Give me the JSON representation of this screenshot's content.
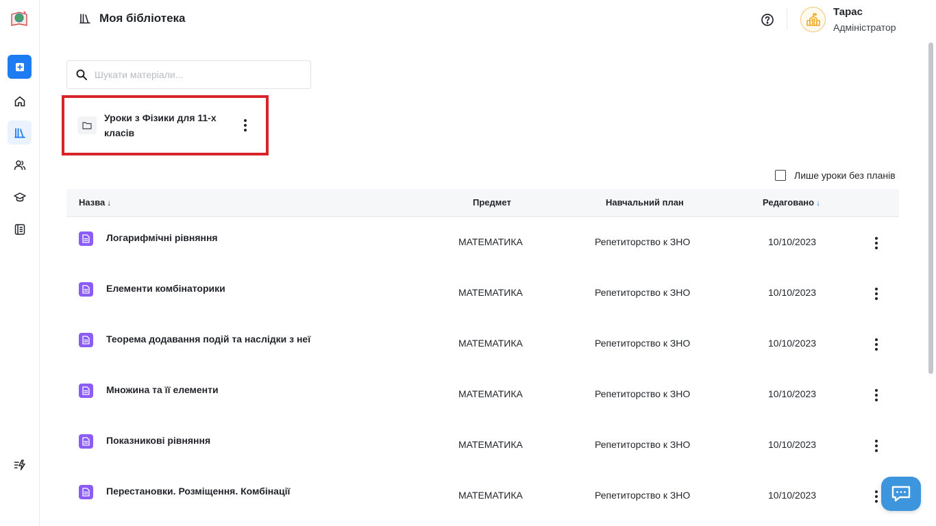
{
  "header": {
    "title": "Моя бібліотека",
    "user_name": "Тарас",
    "user_role": "Адміністратор"
  },
  "sidebar": {
    "items": [
      {
        "icon": "plus-square-icon"
      },
      {
        "icon": "home-icon"
      },
      {
        "icon": "library-icon"
      },
      {
        "icon": "users-icon"
      },
      {
        "icon": "graduation-cap-icon"
      },
      {
        "icon": "journal-icon"
      },
      {
        "icon": "updates-icon"
      }
    ]
  },
  "search": {
    "placeholder": "Шукати матеріали..."
  },
  "folder": {
    "name": "Уроки з Фізики для 11-х класів"
  },
  "filter": {
    "label": "Лише уроки без планів",
    "checked": false
  },
  "table": {
    "headers": {
      "name": "Назва",
      "subject": "Предмет",
      "plan": "Навчальний план",
      "edited": "Редаговано"
    },
    "rows": [
      {
        "name": "Логарифмічні рівняння",
        "subject": "МАТЕМАТИКА",
        "plan": "Репетиторство к ЗНО",
        "date": "10/10/2023"
      },
      {
        "name": "Елементи комбінаторики",
        "subject": "МАТЕМАТИКА",
        "plan": "Репетиторство к ЗНО",
        "date": "10/10/2023"
      },
      {
        "name": "Теорема додавання подій та наслідки з неї",
        "subject": "МАТЕМАТИКА",
        "plan": "Репетиторство к ЗНО",
        "date": "10/10/2023"
      },
      {
        "name": "Множина та її елементи",
        "subject": "МАТЕМАТИКА",
        "plan": "Репетиторство к ЗНО",
        "date": "10/10/2023"
      },
      {
        "name": "Показникові рівняння",
        "subject": "МАТЕМАТИКА",
        "plan": "Репетиторство к ЗНО",
        "date": "10/10/2023"
      },
      {
        "name": "Перестановки. Розміщення. Комбінації",
        "subject": "МАТЕМАТИКА",
        "plan": "Репетиторство к ЗНО",
        "date": "10/10/2023"
      }
    ]
  },
  "colors": {
    "accent": "#1e7cf2",
    "doc_icon": "#8b5cf6",
    "highlight": "#d7232a",
    "chat": "#3c95dd"
  }
}
